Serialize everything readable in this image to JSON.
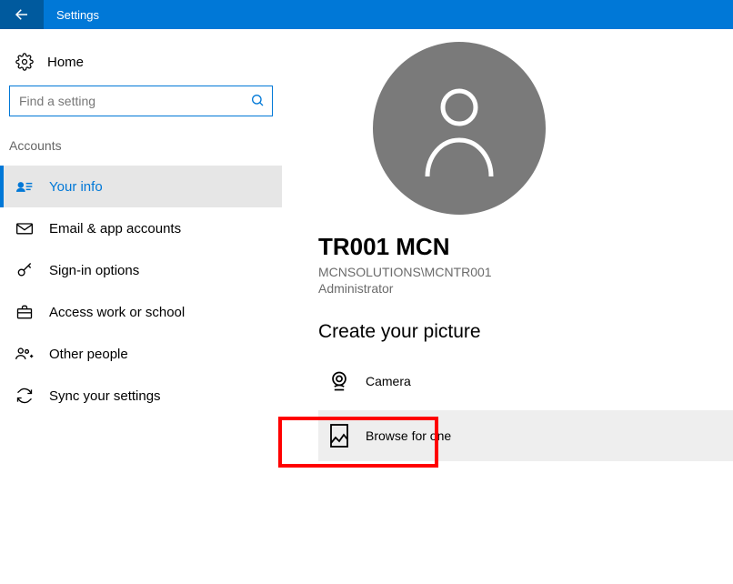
{
  "titlebar": {
    "title": "Settings"
  },
  "sidebar": {
    "home": "Home",
    "search_placeholder": "Find a setting",
    "section": "Accounts",
    "items": [
      {
        "label": "Your info"
      },
      {
        "label": "Email & app accounts"
      },
      {
        "label": "Sign-in options"
      },
      {
        "label": "Access work or school"
      },
      {
        "label": "Other people"
      },
      {
        "label": "Sync your settings"
      }
    ]
  },
  "main": {
    "username": "TR001 MCN",
    "domain_user": "MCNSOLUTIONS\\MCNTR001",
    "role": "Administrator",
    "create_picture_header": "Create your picture",
    "camera_label": "Camera",
    "browse_label": "Browse for one"
  }
}
